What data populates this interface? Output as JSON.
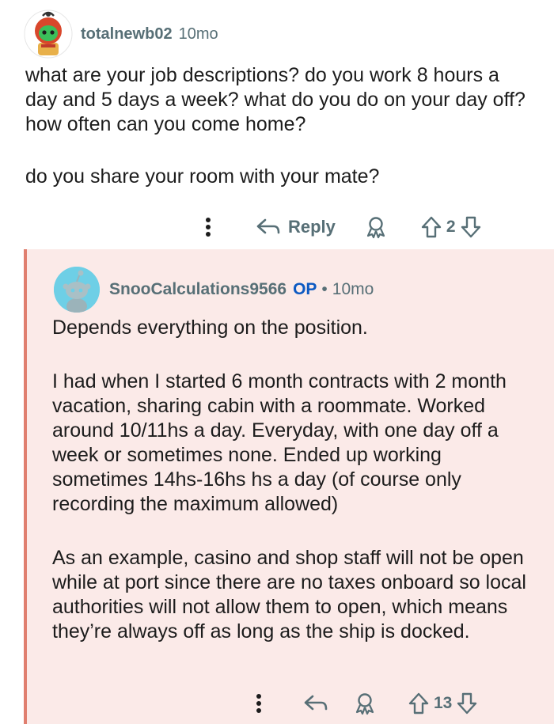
{
  "comment": {
    "username": "totalnewb02",
    "age": "10mo",
    "paragraphs": [
      "what are your job descriptions? do you work 8 hours a day and 5 days a week? what do you do on your day off? how often can you come home?",
      "do you share your room with your mate?"
    ],
    "reply_label": "Reply",
    "score": "2"
  },
  "reply": {
    "username": "SnooCalculations9566",
    "badge": "OP",
    "separator": "•",
    "age": "10mo",
    "paragraphs": [
      "Depends everything on the position.",
      "I had when I started 6 month contracts with 2 month vacation, sharing cabin with a roommate. Worked around 10/11hs a day. Everyday, with one day off a week or sometimes none. Ended up working sometimes 14hs-16hs hs a day (of course only recording the maximum allowed)",
      "As an example, casino and shop staff will not be open while at port since there are no taxes onboard so local authorities will not allow them to open, which means they’re always off as long as the ship is docked."
    ],
    "score": "13"
  },
  "colors": {
    "meta": "#576f76",
    "op_badge": "#0d5ac2",
    "thread_line": "#e07f6f",
    "reply_bg": "#fbeae8",
    "op_avatar_bg": "#6ecfe6"
  },
  "icons": [
    "overflow-menu-icon",
    "reply-arrow-icon",
    "award-icon",
    "upvote-icon",
    "downvote-icon"
  ]
}
